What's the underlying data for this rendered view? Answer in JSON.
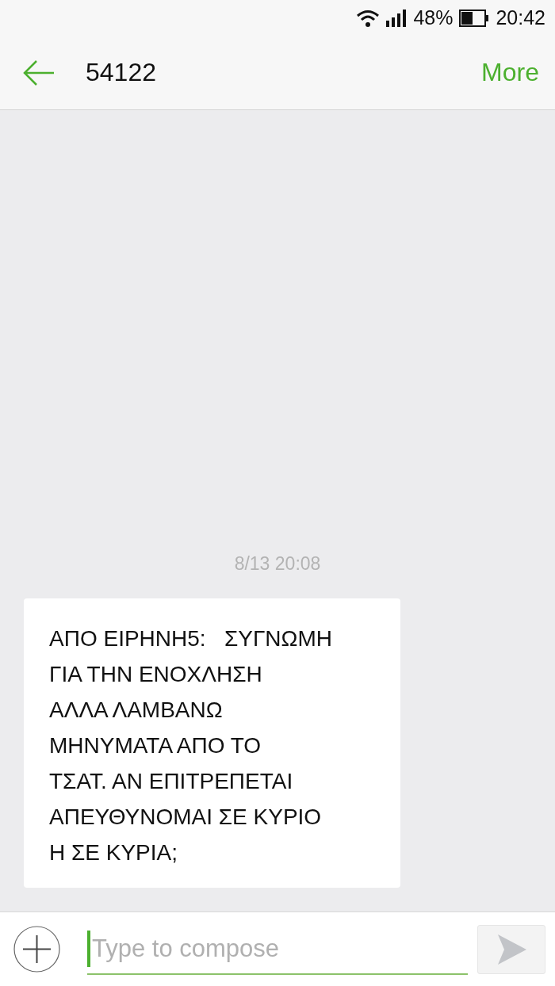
{
  "status_bar": {
    "battery_percent": "48%",
    "time": "20:42"
  },
  "header": {
    "title": "54122",
    "action": "More"
  },
  "conversation": {
    "timestamp": "8/13 20:08",
    "messages": [
      {
        "kind": "incoming",
        "text": "ΑΠΟ ΕΙΡΗΝΗ5:   ΣΥΓΝΩΜΗ\nΓΙΑ ΤΗΝ ΕΝΟΧΛΗΣΗ\nΑΛΛΑ ΛΑΜΒΑΝΩ\nΜΗΝΥΜΑΤΑ ΑΠΟ ΤΟ\nΤΣΑΤ. ΑΝ ΕΠΙΤΡΕΠΕΤΑΙ\nΑΠΕΥΘΥΝΟΜΑΙ ΣΕ ΚΥΡΙΟ\nΗ ΣΕ ΚΥΡΙΑ;"
      }
    ]
  },
  "composer": {
    "placeholder": "Type to compose"
  }
}
